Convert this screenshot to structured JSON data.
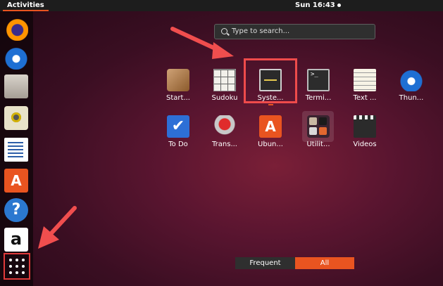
{
  "topbar": {
    "activities": "Activities",
    "clock": "Sun 16:43"
  },
  "dock": {
    "items": [
      "firefox-icon",
      "thunderbird-icon",
      "files-icon",
      "rhythmbox-icon",
      "writer-icon",
      "software-icon",
      "help-icon",
      "amazon-icon"
    ],
    "software_glyph": "A",
    "help_glyph": "?",
    "amazon_glyph": "a"
  },
  "search": {
    "placeholder": "Type to search..."
  },
  "apps": [
    {
      "label": "Start...",
      "icon": "startup-disk-icon"
    },
    {
      "label": "Sudoku",
      "icon": "sudoku-icon"
    },
    {
      "label": "Syste...",
      "icon": "system-monitor-icon"
    },
    {
      "label": "Termi...",
      "icon": "terminal-icon"
    },
    {
      "label": "Text ...",
      "icon": "text-editor-icon"
    },
    {
      "label": "Thun...",
      "icon": "thunderbird-icon"
    },
    {
      "label": "To Do",
      "icon": "todo-icon"
    },
    {
      "label": "Trans...",
      "icon": "transmission-icon"
    },
    {
      "label": "Ubun...",
      "icon": "ubuntu-software-icon"
    },
    {
      "label": "Utilit...",
      "icon": "utilities-icon"
    },
    {
      "label": "Videos",
      "icon": "videos-icon"
    }
  ],
  "glyphs": {
    "terminal": ">_",
    "todo": "✔",
    "ubuntu_software": "A"
  },
  "switcher": {
    "frequent": "Frequent",
    "all": "All"
  },
  "colors": {
    "accent": "#e95420",
    "annotation": "#ef4b4b"
  }
}
